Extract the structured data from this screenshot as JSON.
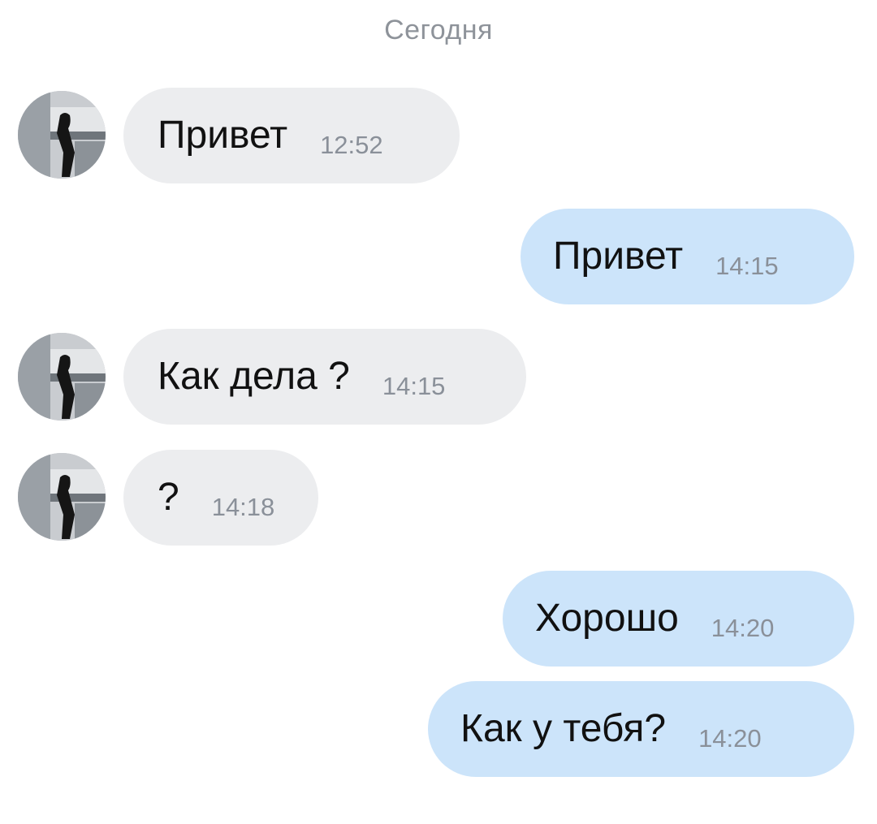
{
  "chat": {
    "date_separator": "Сегодня",
    "messages": [
      {
        "direction": "incoming",
        "text": "Привет",
        "time": "12:52",
        "has_avatar": true
      },
      {
        "direction": "outgoing",
        "text": "Привет",
        "time": "14:15"
      },
      {
        "direction": "incoming",
        "text": "Как дела ?",
        "time": "14:15",
        "has_avatar": true
      },
      {
        "direction": "incoming",
        "text": "?",
        "time": "14:18",
        "has_avatar": true
      },
      {
        "direction": "outgoing",
        "text": "Хорошо",
        "time": "14:20"
      },
      {
        "direction": "outgoing",
        "text": "Как у тебя?",
        "time": "14:20"
      }
    ]
  },
  "colors": {
    "incoming_bubble": "#ecedef",
    "outgoing_bubble": "#cce4fa",
    "time_text": "#8a9099",
    "date_separator_text": "#8e939a"
  }
}
